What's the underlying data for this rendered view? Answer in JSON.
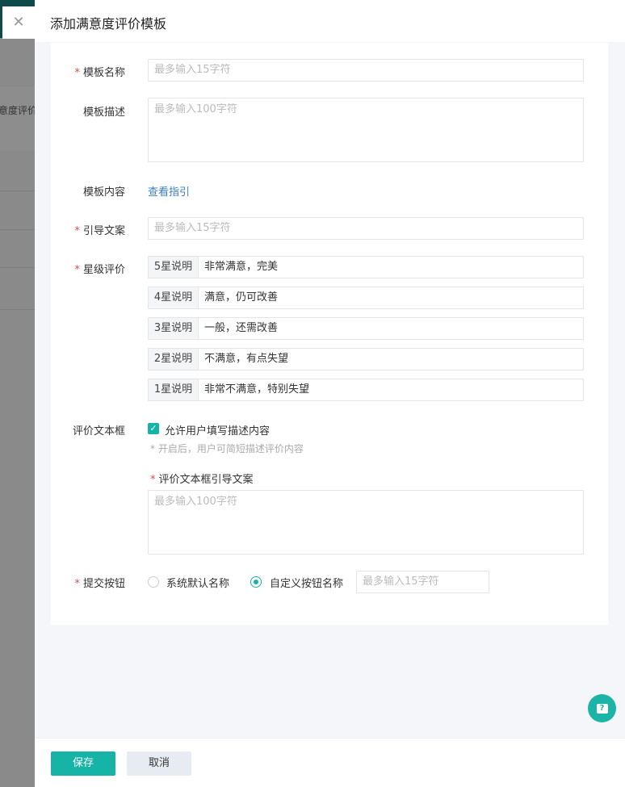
{
  "background": {
    "partial_text": "意度评价"
  },
  "drawer": {
    "title": "添加满意度评价模板"
  },
  "form": {
    "name": {
      "label": "模板名称",
      "placeholder": "最多输入15字符"
    },
    "description": {
      "label": "模板描述",
      "placeholder": "最多输入100字符"
    },
    "content": {
      "label": "模板内容",
      "link": "查看指引"
    },
    "guide_text": {
      "label": "引导文案",
      "placeholder": "最多输入15字符"
    },
    "star_rating": {
      "label": "星级评价",
      "rows": [
        {
          "tag": "5星说明",
          "value": "非常满意，完美"
        },
        {
          "tag": "4星说明",
          "value": "满意，仍可改善"
        },
        {
          "tag": "3星说明",
          "value": "一般，还需改善"
        },
        {
          "tag": "2星说明",
          "value": "不满意，有点失望"
        },
        {
          "tag": "1星说明",
          "value": "非常不满意，特别失望"
        }
      ]
    },
    "text_box": {
      "label": "评价文本框",
      "checkbox_label": "允许用户填写描述内容",
      "checked": true,
      "hint": "* 开启后，用户可简短描述评价内容",
      "guide_label": "评价文本框引导文案",
      "guide_placeholder": "最多输入100字符"
    },
    "submit_button": {
      "label": "提交按钮",
      "option_default": "系统默认名称",
      "option_custom": "自定义按钮名称",
      "selected": "自定义按钮名称",
      "custom_placeholder": "最多输入15字符"
    }
  },
  "footer": {
    "save": "保存",
    "cancel": "取消"
  },
  "colors": {
    "accent": "#16b4a6",
    "required": "#e5484d",
    "link": "#3b7ec8"
  }
}
